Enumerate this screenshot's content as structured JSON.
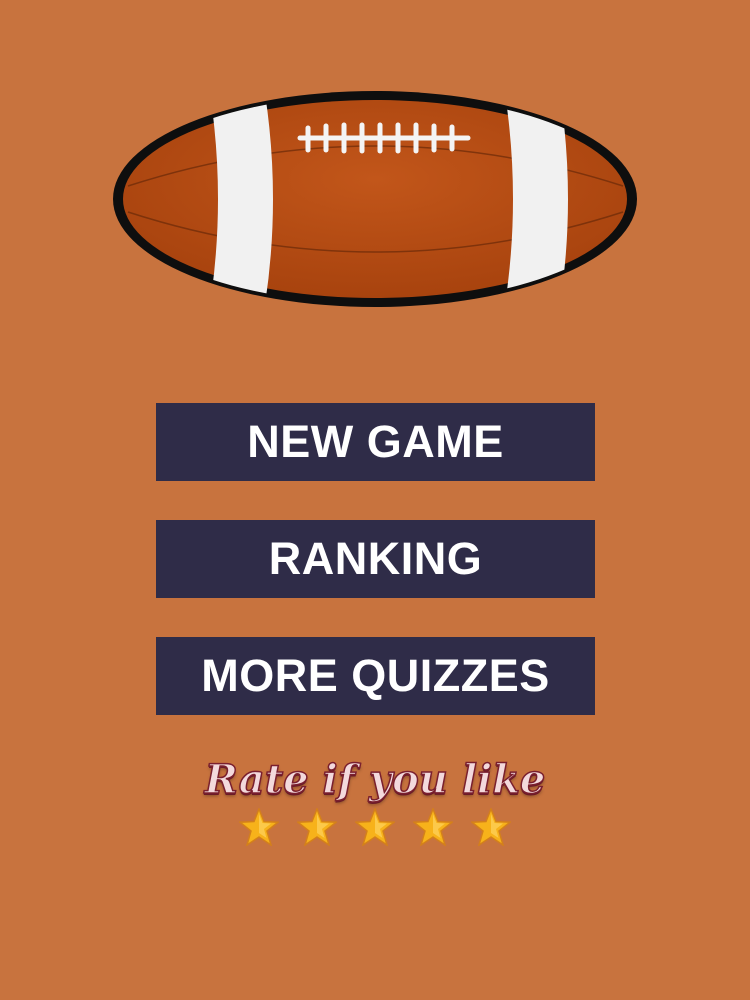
{
  "menu": {
    "new_game": "NEW GAME",
    "ranking": "RANKING",
    "more_quizzes": "MORE QUIZZES"
  },
  "rate": {
    "label": "Rate if you like",
    "stars_total": 5
  },
  "colors": {
    "background": "#c8733e",
    "button_bg": "#2f2c48",
    "button_text": "#ffffff",
    "ball_brown": "#b64d12",
    "ball_outline": "#1a1a1a",
    "star_gold": "#f7b21a",
    "rate_text": "#f3d9dc",
    "rate_outline": "#7a1f2e"
  },
  "icons": {
    "logo": "football-icon",
    "star": "star-icon"
  }
}
